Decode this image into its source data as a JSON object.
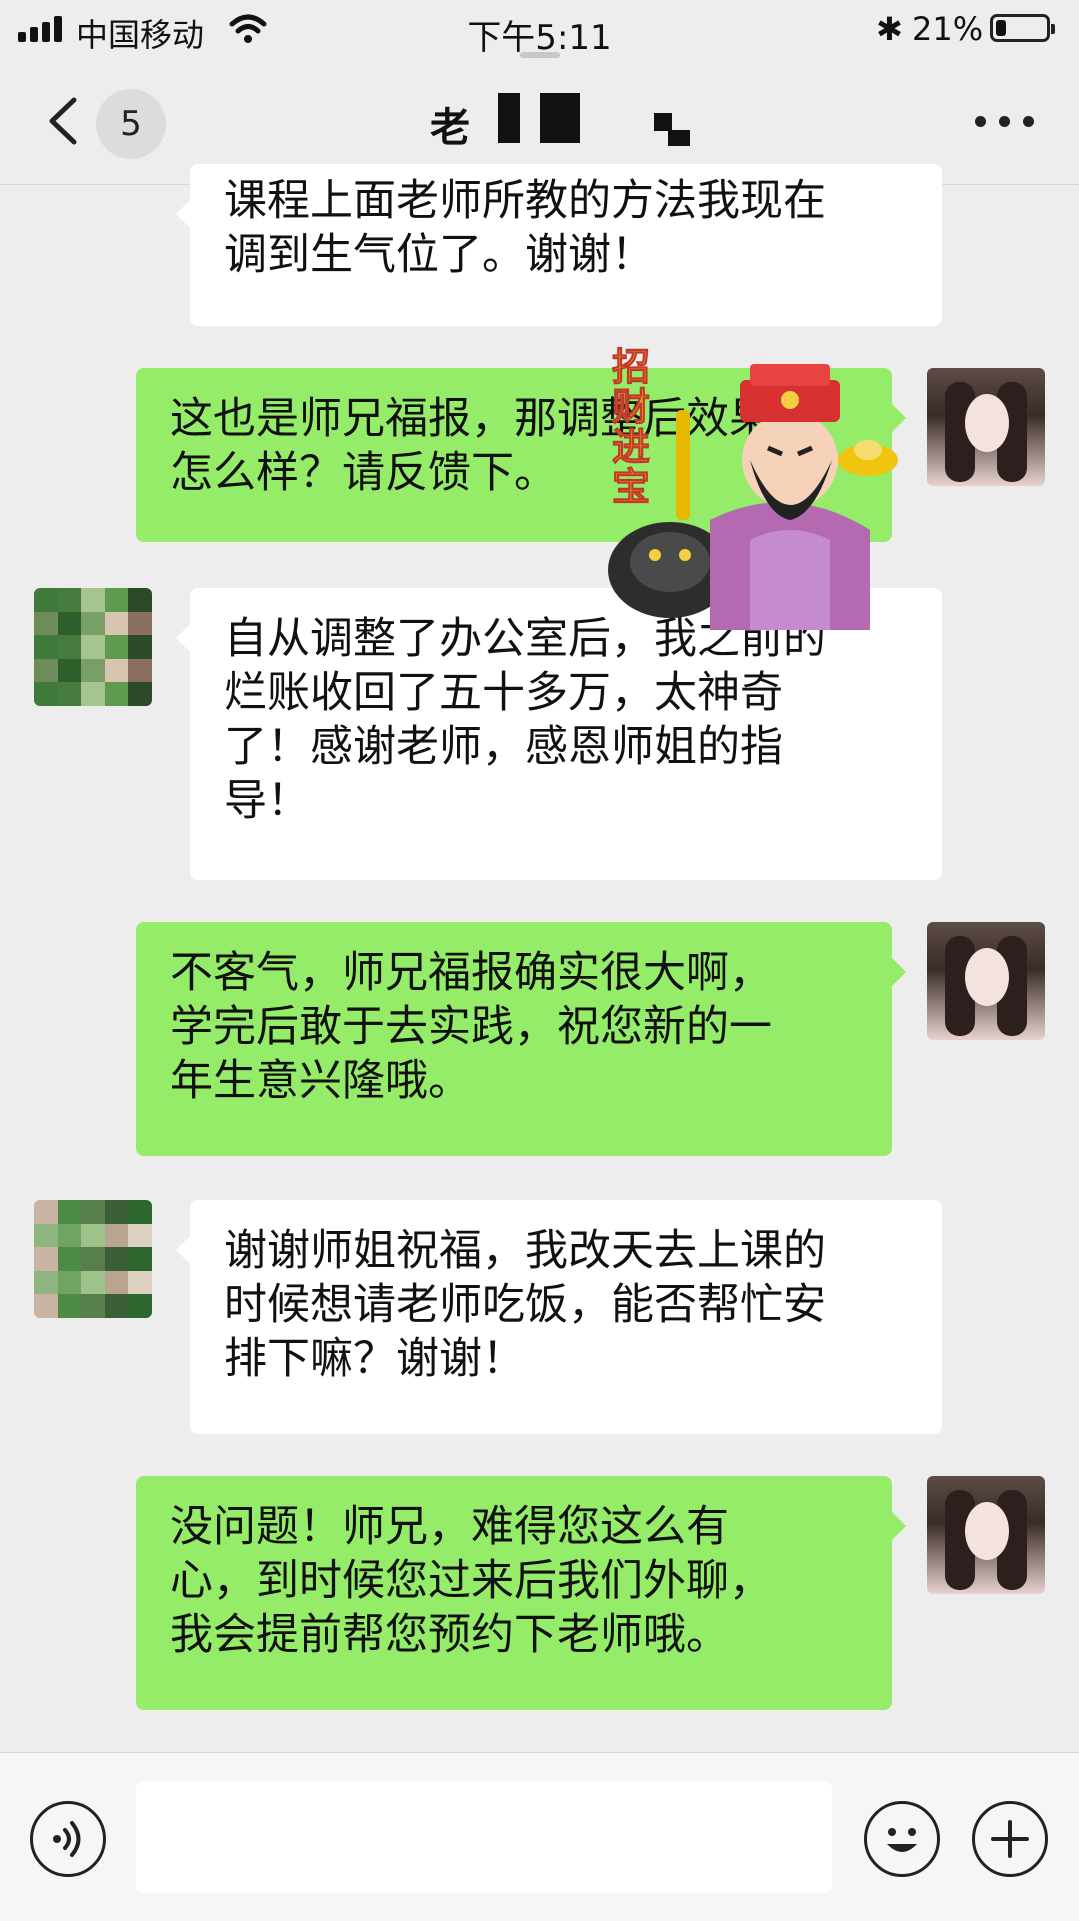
{
  "status_bar": {
    "carrier": "中国移动",
    "time": "下午5:11",
    "bluetooth_icon": "bluetooth-icon",
    "battery_percent": "21%",
    "battery_level": 0.21
  },
  "nav": {
    "back_icon": "chevron-left-icon",
    "unread_count": "5",
    "title_visible": "老",
    "more_icon": "ellipsis-icon"
  },
  "messages": [
    {
      "side": "other",
      "text": "课程上面老师所教的方法我现在\n调到生气位了。谢谢！"
    },
    {
      "side": "me",
      "text": "这也是师兄福报，那调整后效果\n怎么样？请反馈下。"
    },
    {
      "side": "other",
      "text": "自从调整了办公室后，我之前的\n烂账收回了五十多万，太神奇\n了！感谢老师，感恩师姐的指\n导！"
    },
    {
      "side": "me",
      "text": "不客气，师兄福报确实很大啊，\n学完后敢于去实践，祝您新的一\n年生意兴隆哦。"
    },
    {
      "side": "other",
      "text": "谢谢师姐祝福，我改天去上课的\n时候想请老师吃饭，能否帮忙安\n排下嘛？谢谢！"
    },
    {
      "side": "me",
      "text": "没问题！师兄，难得您这么有\n心，到时候您过来后我们外聊，\n我会提前帮您预约下老师哦。"
    }
  ],
  "sticker": {
    "text": "招财进宝"
  },
  "input_bar": {
    "voice_icon": "voice-icon",
    "input_value": "",
    "emoji_icon": "smiley-icon",
    "plus_icon": "plus-circle-icon"
  },
  "colors": {
    "background": "#ededed",
    "green_bubble": "#95ec69",
    "white_bubble": "#ffffff"
  }
}
